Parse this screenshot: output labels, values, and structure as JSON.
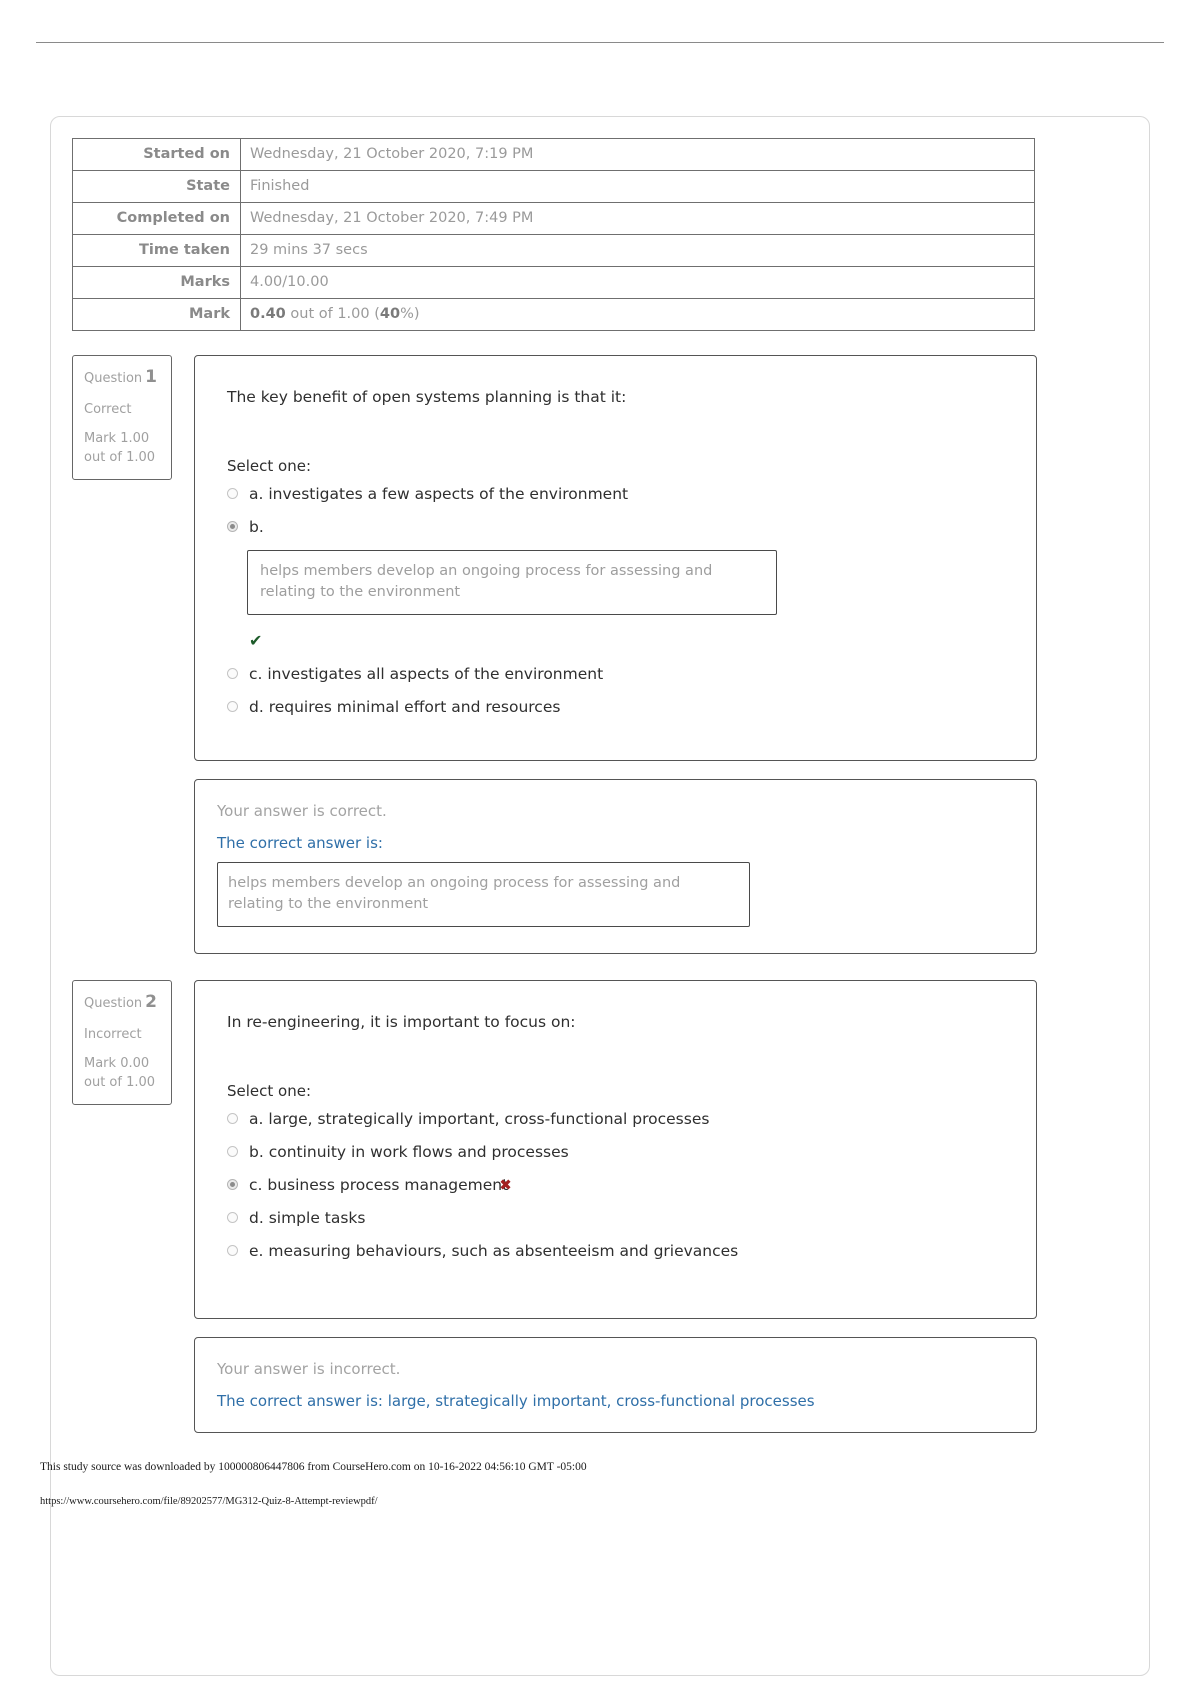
{
  "summary": {
    "rows": [
      {
        "key": "Started on",
        "value": "Wednesday, 21 October 2020, 7:19 PM"
      },
      {
        "key": "State",
        "value": "Finished"
      },
      {
        "key": "Completed on",
        "value": "Wednesday, 21 October 2020, 7:49 PM"
      },
      {
        "key": "Time taken",
        "value": "29 mins 37 secs"
      },
      {
        "key": "Marks",
        "value": "4.00/10.00"
      }
    ],
    "mark_row": {
      "key": "Mark",
      "score": "0.40",
      "middle": " out of 1.00 (",
      "percent": "40",
      "suffix": "%)"
    }
  },
  "questions": [
    {
      "sidebar": {
        "label": "Question",
        "number": "1",
        "state": "Correct",
        "mark": "Mark 1.00 out of 1.00"
      },
      "text": "The key benefit of open systems planning is that it:",
      "select_one": "Select one:",
      "options": [
        {
          "letter": "a.",
          "label": "a. investigates a few aspects of the environment",
          "checked": false,
          "boxed": null,
          "mark_icon": null
        },
        {
          "letter": "b.",
          "label": "b.",
          "checked": true,
          "boxed": "helps members develop an ongoing process for assessing and relating to the environment",
          "mark_icon": "check-icon"
        },
        {
          "letter": "c.",
          "label": "c. investigates all aspects of the environment",
          "checked": false,
          "boxed": null,
          "mark_icon": null
        },
        {
          "letter": "d.",
          "label": "d. requires minimal effort and resources",
          "checked": false,
          "boxed": null,
          "mark_icon": null
        }
      ],
      "feedback": {
        "verdict": "Your answer is correct.",
        "correct_label": "The correct answer is:",
        "correct_boxed": "helps members develop an ongoing process for assessing and relating to the environment",
        "correct_inline": null
      }
    },
    {
      "sidebar": {
        "label": "Question",
        "number": "2",
        "state": "Incorrect",
        "mark": "Mark 0.00 out of 1.00"
      },
      "text": "In re-engineering, it is important to focus on:",
      "select_one": "Select one:",
      "options": [
        {
          "letter": "a.",
          "label": "a. large, strategically important, cross-functional processes",
          "checked": false,
          "boxed": null,
          "mark_icon": null
        },
        {
          "letter": "b.",
          "label": "b. continuity in work flows and processes",
          "checked": false,
          "boxed": null,
          "mark_icon": null
        },
        {
          "letter": "c.",
          "label": "c. business process management",
          "checked": true,
          "boxed": null,
          "mark_icon": "cross-icon"
        },
        {
          "letter": "d.",
          "label": "d. simple tasks",
          "checked": false,
          "boxed": null,
          "mark_icon": null
        },
        {
          "letter": "e.",
          "label": "e. measuring behaviours, such as absenteeism and grievances",
          "checked": false,
          "boxed": null,
          "mark_icon": null
        }
      ],
      "feedback": {
        "verdict": "Your answer is incorrect.",
        "correct_label": null,
        "correct_boxed": null,
        "correct_inline": "The correct answer is: large, strategically important, cross-functional processes"
      }
    }
  ],
  "footer": {
    "note": "This study source was downloaded by 100000806447806 from CourseHero.com on 10-16-2022 04:56:10 GMT -05:00",
    "url": "https://www.coursehero.com/file/89202577/MG312-Quiz-8-Attempt-reviewpdf/"
  },
  "glyphs": {
    "check": "✔",
    "cross": "✖"
  },
  "colors": {
    "correct_green": "#1d5b2a",
    "incorrect_red": "#a32020",
    "link_blue": "#2f6fa8",
    "muted_gray": "#a0a0a0"
  }
}
